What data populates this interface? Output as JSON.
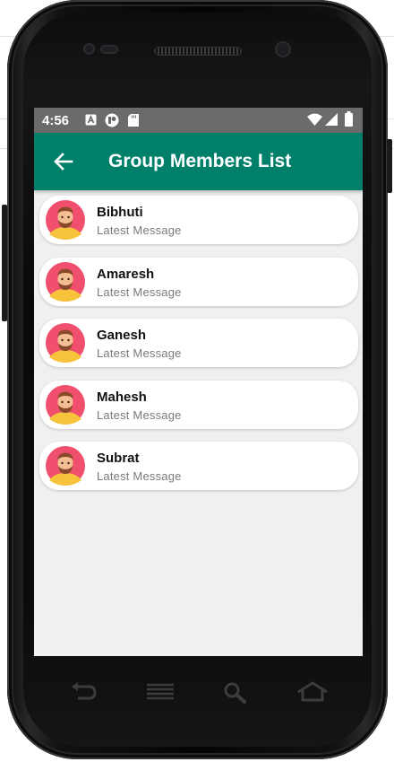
{
  "status_bar": {
    "time": "4:56",
    "icons": [
      "a-box-icon",
      "media-icon",
      "sd-card-icon",
      "wifi-icon",
      "signal-icon",
      "battery-icon"
    ]
  },
  "app_bar": {
    "title": "Group Members List",
    "back_icon": "arrow-left-icon",
    "color": "#00806a"
  },
  "members": [
    {
      "name": "Bibhuti",
      "message": "Latest Message"
    },
    {
      "name": "Amaresh",
      "message": "Latest Message"
    },
    {
      "name": "Ganesh",
      "message": "Latest Message"
    },
    {
      "name": "Mahesh",
      "message": "Latest Message"
    },
    {
      "name": "Subrat",
      "message": "Latest Message"
    }
  ],
  "nav_keys": [
    "back-key-icon",
    "menu-key-icon",
    "search-key-icon",
    "home-key-icon"
  ]
}
